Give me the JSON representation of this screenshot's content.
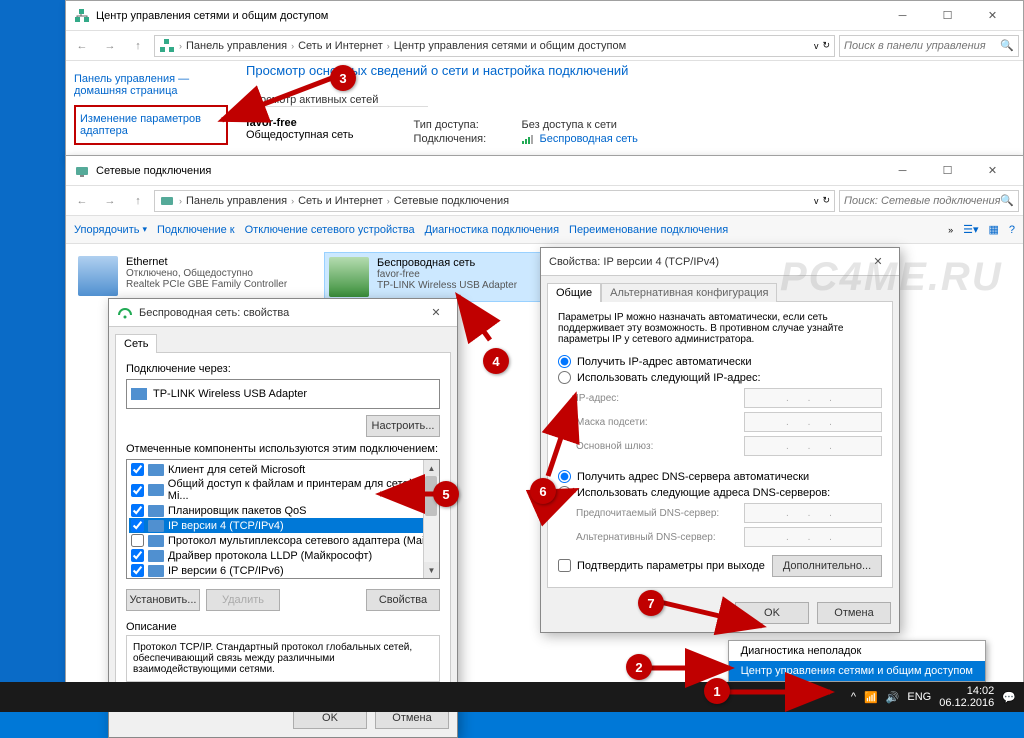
{
  "window1": {
    "title": "Центр управления сетями и общим доступом",
    "breadcrumb": [
      "Панель управления",
      "Сеть и Интернет",
      "Центр управления сетями и общим доступом"
    ],
    "search_placeholder": "Поиск в панели управления",
    "sidebar": {
      "home": "Панель управления — домашняя страница",
      "change_adapter": "Изменение параметров адаптера"
    },
    "page_title": "Просмотр основных сведений о сети и настройка подключений",
    "active_networks_label": "Просмотр активных сетей",
    "network_name": "favor-free",
    "network_type": "Общедоступная сеть",
    "fields": {
      "access_type_label": "Тип доступа:",
      "access_type_value": "Без доступа к сети",
      "connections_label": "Подключения:",
      "connections_value": "Беспроводная сеть"
    }
  },
  "window2": {
    "title": "Сетевые подключения",
    "breadcrumb": [
      "Панель управления",
      "Сеть и Интернет",
      "Сетевые подключения"
    ],
    "search_placeholder": "Поиск: Сетевые подключения",
    "toolbar": {
      "organize": "Упорядочить",
      "connect_to": "Подключение к",
      "disable": "Отключение сетевого устройства",
      "diagnose": "Диагностика подключения",
      "rename": "Переименование подключения"
    },
    "adapters": [
      {
        "name": "Ethernet",
        "status": "Отключено, Общедоступно",
        "device": "Realtek PCIe GBE Family Controller"
      },
      {
        "name": "Беспроводная сеть",
        "status": "favor-free",
        "device": "TP-LINK Wireless USB Adapter"
      }
    ]
  },
  "dlg_props": {
    "title": "Беспроводная сеть: свойства",
    "tab_net": "Сеть",
    "connect_using_label": "Подключение через:",
    "connect_using_value": "TP-LINK Wireless USB Adapter",
    "configure_btn": "Настроить...",
    "components_label": "Отмеченные компоненты используются этим подключением:",
    "components": [
      {
        "checked": true,
        "label": "Клиент для сетей Microsoft"
      },
      {
        "checked": true,
        "label": "Общий доступ к файлам и принтерам для сетей Mi..."
      },
      {
        "checked": true,
        "label": "Планировщик пакетов QoS"
      },
      {
        "checked": true,
        "label": "IP версии 4 (TCP/IPv4)",
        "selected": true
      },
      {
        "checked": false,
        "label": "Протокол мультиплексора сетевого адаптера (Mai..."
      },
      {
        "checked": true,
        "label": "Драйвер протокола LLDP (Майкрософт)"
      },
      {
        "checked": true,
        "label": "IP версии 6 (TCP/IPv6)"
      }
    ],
    "install_btn": "Установить...",
    "uninstall_btn": "Удалить",
    "props_btn": "Свойства",
    "desc_label": "Описание",
    "desc_text": "Протокол TCP/IP. Стандартный протокол глобальных сетей, обеспечивающий связь между различными взаимодействующими сетями.",
    "ok": "OK",
    "cancel": "Отмена"
  },
  "dlg_ipv4": {
    "title": "Свойства: IP версии 4 (TCP/IPv4)",
    "tab_general": "Общие",
    "tab_alt": "Альтернативная конфигурация",
    "intro": "Параметры IP можно назначать автоматически, если сеть поддерживает эту возможность. В противном случае узнайте параметры IP у сетевого администратора.",
    "radio_ip_auto": "Получить IP-адрес автоматически",
    "radio_ip_manual": "Использовать следующий IP-адрес:",
    "ip_label": "IP-адрес:",
    "mask_label": "Маска подсети:",
    "gateway_label": "Основной шлюз:",
    "radio_dns_auto": "Получить адрес DNS-сервера автоматически",
    "radio_dns_manual": "Использовать следующие адреса DNS-серверов:",
    "dns1_label": "Предпочитаемый DNS-сервер:",
    "dns2_label": "Альтернативный DNS-сервер:",
    "confirm_on_exit": "Подтвердить параметры при выходе",
    "advanced_btn": "Дополнительно...",
    "ok": "OK",
    "cancel": "Отмена"
  },
  "context_menu": {
    "diagnose": "Диагностика неполадок",
    "open_center": "Центр управления сетями и общим доступом"
  },
  "taskbar": {
    "lang": "ENG",
    "time": "14:02",
    "date": "06.12.2016"
  },
  "watermark": "PC4ME.RU",
  "dots": ". . ."
}
